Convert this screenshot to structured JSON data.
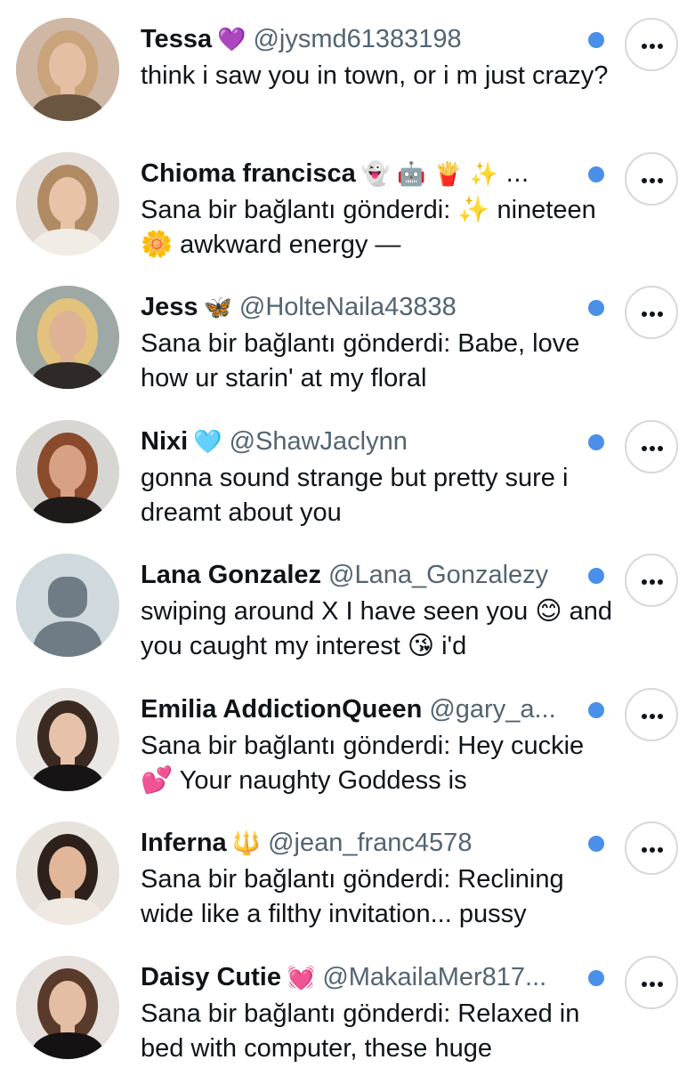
{
  "messages": [
    {
      "name": "Tessa",
      "name_emoji": "💜",
      "handle": "@jysmd61383198",
      "preview": "think i saw you in town, or i m just crazy?",
      "avatar_colors": {
        "bg": "#cfb7a6",
        "skin": "#e5bfa4",
        "hair": "#c9a37a",
        "top": "#6b5642"
      }
    },
    {
      "name": "Chioma francisca",
      "name_emoji": "👻 🤖 🍟 ✨ …",
      "handle": "",
      "preview": "Sana bir bağlantı gönderdi: ✨ nineteen 🌼 awkward energy —",
      "avatar_colors": {
        "bg": "#e3dcd6",
        "skin": "#e8c3a8",
        "hair": "#b08a62",
        "top": "#f1ece6"
      }
    },
    {
      "name": "Jess",
      "name_emoji": "🦋",
      "handle": "@HolteNaila43838",
      "preview": "Sana bir bağlantı gönderdi: Babe, love how ur starin' at my floral",
      "avatar_colors": {
        "bg": "#9ea8a4",
        "skin": "#e0b295",
        "hair": "#e2c27c",
        "top": "#2f2a27"
      }
    },
    {
      "name": "Nixi",
      "name_emoji": "🩵",
      "handle": "@ShawJaclynn",
      "preview": "gonna sound strange but pretty sure i dreamt about you",
      "avatar_colors": {
        "bg": "#d8d6d2",
        "skin": "#d9a184",
        "hair": "#8a4a2c",
        "top": "#1e1a1a"
      }
    },
    {
      "name": "Lana Gonzalez",
      "name_emoji": "",
      "handle": "@Lana_Gonzalezy",
      "preview": "swiping around X I have seen you 😊 and you caught my interest 😘 i'd",
      "avatar_colors": {
        "bg": "#cfd9de",
        "skin": "#6f7c85",
        "hair": "#6f7c85",
        "top": "#6f7c85"
      }
    },
    {
      "name": "Emilia AddictionQueen",
      "name_emoji": "",
      "handle": "@gary_a...",
      "preview": "Sana bir bağlantı gönderdi: Hey cuckie 💕 Your naughty Goddess is",
      "avatar_colors": {
        "bg": "#e9e6e3",
        "skin": "#e7c2aa",
        "hair": "#3b2a22",
        "top": "#161414"
      }
    },
    {
      "name": "Inferna",
      "name_emoji": "🔱",
      "handle": "@jean_franc4578",
      "preview": "Sana bir bağlantı gönderdi: Reclining wide like a filthy invitation... pussy",
      "avatar_colors": {
        "bg": "#e8e2dd",
        "skin": "#e2b699",
        "hair": "#2e211b",
        "top": "#efe9e2"
      }
    },
    {
      "name": "Daisy Cutie",
      "name_emoji": "💓",
      "handle": "@MakailaMer817...",
      "preview": "Sana bir bağlantı gönderdi: Relaxed in bed with computer, these huge",
      "avatar_colors": {
        "bg": "#e6e0dc",
        "skin": "#e4bea4",
        "hair": "#5a3a2a",
        "top": "#141212"
      }
    }
  ]
}
